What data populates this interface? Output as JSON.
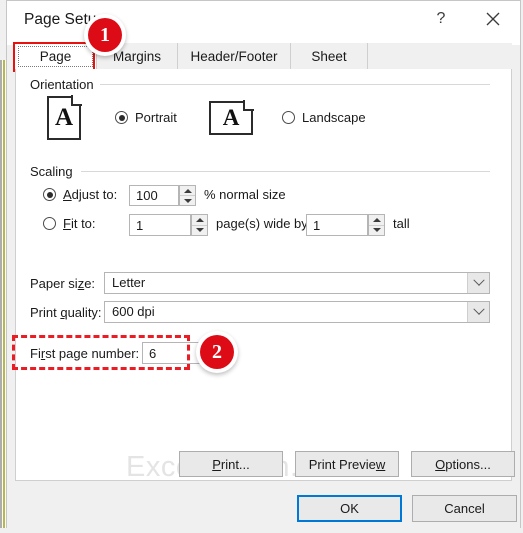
{
  "window": {
    "title": "Page Setup",
    "help_icon": "question-mark-icon",
    "close_icon": "close-icon"
  },
  "tabs": [
    {
      "label": "Page",
      "selected": true
    },
    {
      "label": "Margins",
      "selected": false
    },
    {
      "label": "Header/Footer",
      "selected": false
    },
    {
      "label": "Sheet",
      "selected": false
    }
  ],
  "orientation": {
    "group_label": "Orientation",
    "portrait": {
      "label": "Portrait",
      "selected": true,
      "icon_glyph": "A"
    },
    "landscape": {
      "label": "Landscape",
      "selected": false,
      "icon_glyph": "A"
    }
  },
  "scaling": {
    "group_label": "Scaling",
    "adjust_to": {
      "label": "Adjust to:",
      "selected": true,
      "value": "100",
      "suffix": "% normal size"
    },
    "fit_to": {
      "label": "Fit to:",
      "selected": false,
      "wide_value": "1",
      "middle_text": "page(s) wide by",
      "tall_value": "1",
      "suffix": "tall"
    }
  },
  "paper_size": {
    "label": "Paper size:",
    "value": "Letter"
  },
  "print_quality": {
    "label": "Print quality:",
    "value": "600 dpi"
  },
  "first_page_number": {
    "label": "First page number:",
    "value": "6"
  },
  "annotations": {
    "badge_one": "1",
    "badge_two": "2",
    "highlight_color": "#e8110f",
    "dashed_color": "#ec1c24",
    "badge_color": "#dd0b16"
  },
  "watermark": {
    "text": "Excelbilearn.com"
  },
  "buttons": {
    "print": "Print...",
    "print_preview": "Print Preview",
    "options": "Options...",
    "ok": "OK",
    "cancel": "Cancel"
  }
}
